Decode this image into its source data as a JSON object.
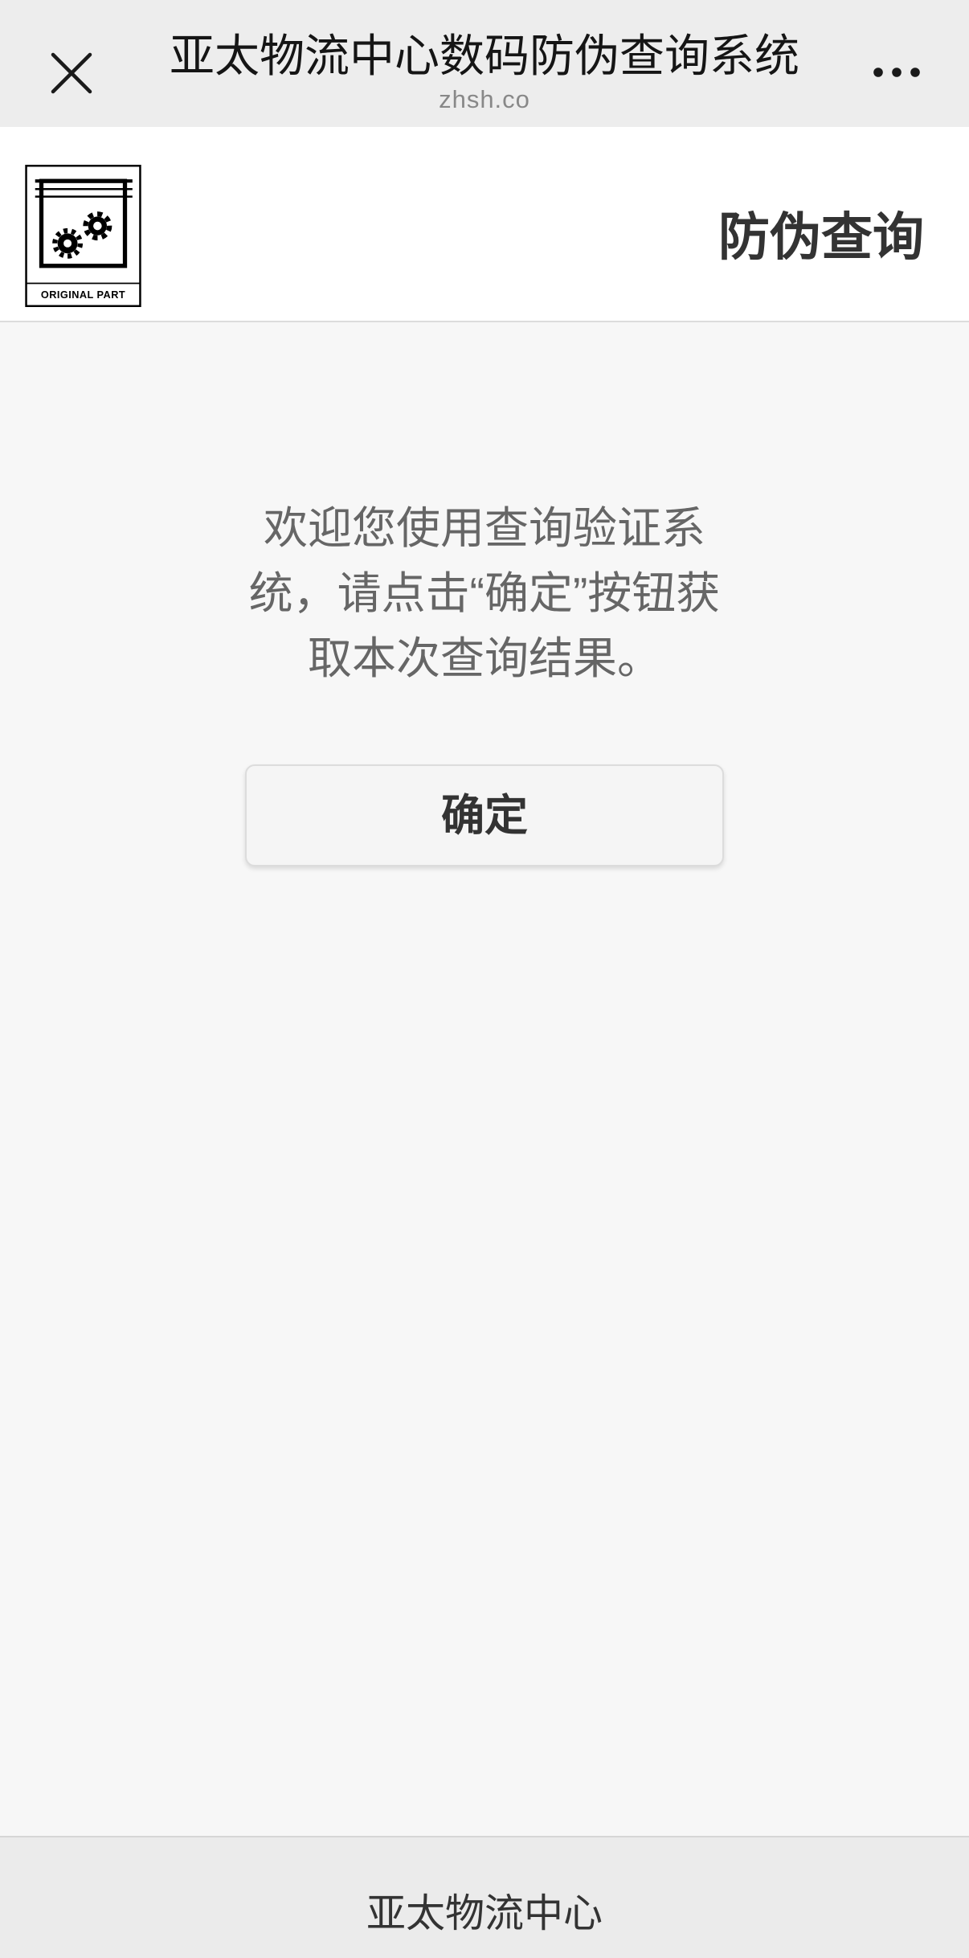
{
  "topbar": {
    "title": "亚太物流中心数码防伪查询系统",
    "domain": "zhsh.co",
    "close_icon": "close-icon",
    "more_icon": "more-icon"
  },
  "header": {
    "logo_icon": "original-part-logo",
    "logo_text": "ORIGINAL PART",
    "page_title": "防伪查询"
  },
  "main": {
    "message_lines": [
      "欢迎您使用查询验证系",
      "统，请点击“确定”按钮获",
      "取本次查询结果。"
    ],
    "confirm_label": "确定"
  },
  "footer": {
    "text": "亚太物流中心"
  },
  "colors": {
    "topbar_bg": "#ededed",
    "header_bg": "#ffffff",
    "page_bg": "#f7f7f7",
    "footer_bg": "#ebebeb",
    "primary_text": "#333333",
    "message_text": "#666666",
    "subtitle_text": "#888888"
  }
}
